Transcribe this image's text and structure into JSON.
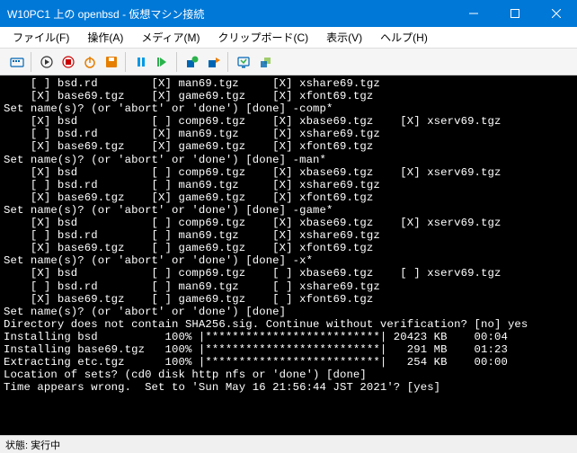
{
  "window": {
    "title": "W10PC1 上の openbsd - 仮想マシン接続",
    "min_label": "Minimize",
    "max_label": "Maximize",
    "close_label": "Close"
  },
  "menu": {
    "file": "ファイル(F)",
    "action": "操作(A)",
    "media": "メディア(M)",
    "clipboard": "クリップボード(C)",
    "view": "表示(V)",
    "help": "ヘルプ(H)"
  },
  "status": {
    "label": "状態:",
    "value": "実行中"
  },
  "terminal_lines": [
    "    [ ] bsd.rd        [X] man69.tgz     [X] xshare69.tgz",
    "    [X] base69.tgz    [X] game69.tgz    [X] xfont69.tgz",
    "Set name(s)? (or 'abort' or 'done') [done] -comp*",
    "    [X] bsd           [ ] comp69.tgz    [X] xbase69.tgz    [X] xserv69.tgz",
    "    [ ] bsd.rd        [X] man69.tgz     [X] xshare69.tgz",
    "    [X] base69.tgz    [X] game69.tgz    [X] xfont69.tgz",
    "Set name(s)? (or 'abort' or 'done') [done] -man*",
    "    [X] bsd           [ ] comp69.tgz    [X] xbase69.tgz    [X] xserv69.tgz",
    "    [ ] bsd.rd        [ ] man69.tgz     [X] xshare69.tgz",
    "    [X] base69.tgz    [X] game69.tgz    [X] xfont69.tgz",
    "Set name(s)? (or 'abort' or 'done') [done] -game*",
    "    [X] bsd           [ ] comp69.tgz    [X] xbase69.tgz    [X] xserv69.tgz",
    "    [ ] bsd.rd        [ ] man69.tgz     [X] xshare69.tgz",
    "    [X] base69.tgz    [ ] game69.tgz    [X] xfont69.tgz",
    "Set name(s)? (or 'abort' or 'done') [done] -x*",
    "    [X] bsd           [ ] comp69.tgz    [ ] xbase69.tgz    [ ] xserv69.tgz",
    "    [ ] bsd.rd        [ ] man69.tgz     [ ] xshare69.tgz",
    "    [X] base69.tgz    [ ] game69.tgz    [ ] xfont69.tgz",
    "Set name(s)? (or 'abort' or 'done') [done]",
    "Directory does not contain SHA256.sig. Continue without verification? [no] yes",
    "Installing bsd          100% |**************************| 20423 KB    00:04",
    "Installing base69.tgz   100% |**************************|   291 MB    01:23",
    "Extracting etc.tgz      100% |**************************|   254 KB    00:00",
    "Location of sets? (cd0 disk http nfs or 'done') [done]",
    "Time appears wrong.  Set to 'Sun May 16 21:56:44 JST 2021'? [yes]"
  ]
}
